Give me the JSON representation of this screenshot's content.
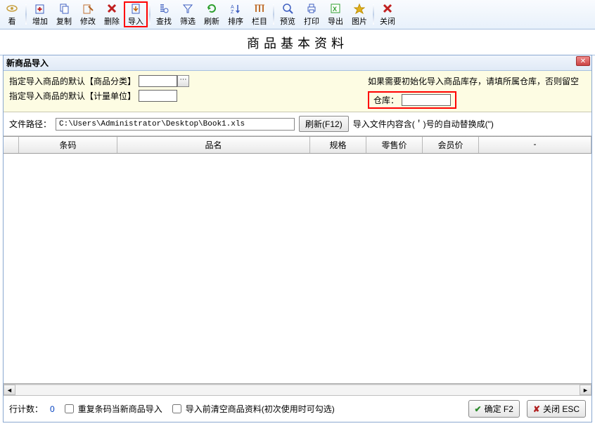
{
  "toolbar": {
    "items": [
      {
        "label": "看",
        "icon": "eye",
        "color": "#c8a040"
      },
      {
        "label": "增加",
        "icon": "plus",
        "color": "#4060c0"
      },
      {
        "label": "复制",
        "icon": "copy",
        "color": "#4060c0"
      },
      {
        "label": "修改",
        "icon": "edit",
        "color": "#c07030"
      },
      {
        "label": "删除",
        "icon": "x-red",
        "color": "#c02020",
        "truncated_label": "删除"
      },
      {
        "label": "导入",
        "icon": "import",
        "color": "#4060c0",
        "active": true
      },
      {
        "label": "查找",
        "icon": "search",
        "color": "#4060c0"
      },
      {
        "label": "筛选",
        "icon": "filter",
        "color": "#4060c0"
      },
      {
        "label": "刷新",
        "icon": "refresh",
        "color": "#30a030"
      },
      {
        "label": "排序",
        "icon": "sort",
        "color": "#4060c0"
      },
      {
        "label": "栏目",
        "icon": "columns",
        "color": "#c07030"
      },
      {
        "label": "预览",
        "icon": "preview",
        "color": "#4060c0"
      },
      {
        "label": "打印",
        "icon": "print",
        "color": "#4060c0"
      },
      {
        "label": "导出",
        "icon": "export-xls",
        "color": "#30a030"
      },
      {
        "label": "图片",
        "icon": "image",
        "color": "#c0a020"
      },
      {
        "label": "关闭",
        "icon": "close-x",
        "color": "#c02020"
      }
    ],
    "separators_after": [
      0,
      5,
      10,
      14
    ]
  },
  "page_title": "商品基本资料",
  "dialog": {
    "title": "新商品导入",
    "close_text": "✕",
    "form": {
      "category_label": "指定导入商品的默认【商品分类】",
      "category_value": "",
      "unit_label": "指定导入商品的默认【计量单位】",
      "unit_value": "",
      "init_hint": "如果需要初始化导入商品库存，请填所属仓库，否则留空",
      "warehouse_label": "仓库：",
      "warehouse_value": ""
    },
    "path": {
      "label": "文件路径：",
      "value": "C:\\Users\\Administrator\\Desktop\\Book1.xls",
      "refresh_btn": "刷新(F12)",
      "hint": "导入文件内容含(＇)号的自动替换成(\")"
    },
    "grid": {
      "columns": [
        "",
        "条码",
        "品名",
        "规格",
        "零售价",
        "会员价",
        "-"
      ],
      "rows": []
    },
    "footer": {
      "row_count_label": "行计数：",
      "row_count": "0",
      "chk_dup": "重复条码当新商品导入",
      "chk_clear": "导入前清空商品资料(初次使用时可勾选)",
      "ok_label": "确定 F2",
      "cancel_label": "关闭 ESC"
    }
  }
}
